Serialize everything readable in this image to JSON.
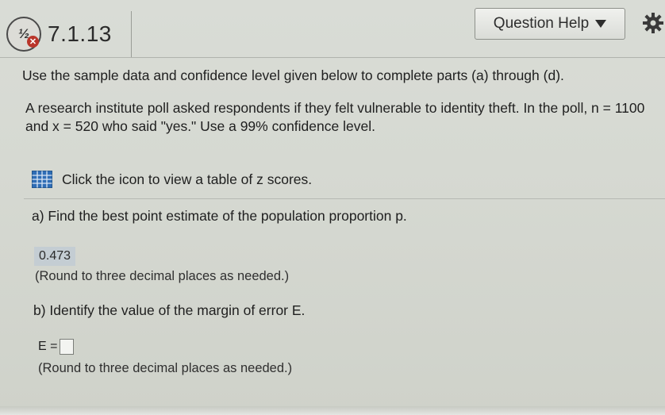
{
  "header": {
    "question_id": "7.1.13",
    "status_icon_fraction": "½",
    "help_button_label": "Question Help"
  },
  "content": {
    "instructions": "Use the sample data and confidence level given below to complete parts (a) through (d).",
    "problem_text": "A research institute poll asked respondents if they felt vulnerable to identity theft. In the poll, n = 1100 and x = 520 who said \"yes.\" Use a 99% confidence level.",
    "table_link_label": "Click the icon to view a table of z scores.",
    "part_a": {
      "prompt": "a) Find the best point estimate of the population proportion p.",
      "answer": "0.473",
      "rounding_note": "(Round to three decimal places as needed.)"
    },
    "part_b": {
      "prompt": "b) Identify the value of the margin of error E.",
      "field_label": "E =",
      "field_value": "",
      "rounding_note": "(Round to three decimal places as needed.)"
    }
  },
  "colors": {
    "answer_highlight": "#c4cdd3",
    "error_mark": "#b9352a",
    "table_icon": "#2f6db5"
  }
}
